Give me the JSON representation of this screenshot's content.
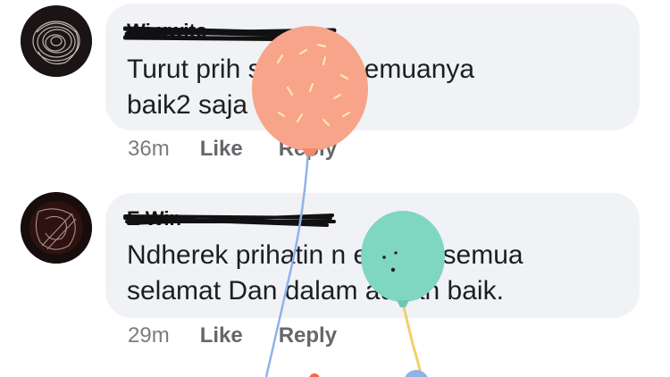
{
  "comments": [
    {
      "author": "Wi                  uwito",
      "text": "Turut prih              semoga semuanya\nbaik2 saja",
      "time": "36m",
      "like_label": "Like",
      "reply_label": "Reply"
    },
    {
      "author": "E                  Win",
      "text": "Ndherek prihatin n         emoga semua\nselamat Dan dalam        adaan baik.",
      "time": "29m",
      "like_label": "Like",
      "reply_label": "Reply"
    }
  ],
  "colors": {
    "bubble": "#f0f2f5",
    "meta_text": "#65676b",
    "balloon_pink": "#f7a48a",
    "balloon_teal": "#7fd6c1",
    "balloon_string_blue": "#8fb3e8",
    "balloon_string_yellow": "#f2cf6b"
  }
}
